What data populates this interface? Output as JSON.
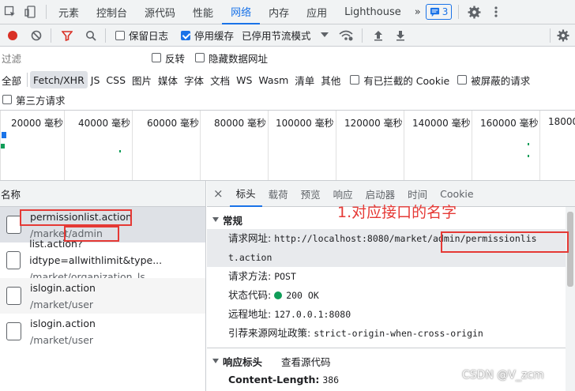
{
  "topbar": {
    "tabs": [
      "元素",
      "控制台",
      "源代码",
      "性能",
      "网络",
      "内存",
      "应用",
      "Lighthouse"
    ],
    "active_tab": "网络",
    "more": "»",
    "issues_count": "3"
  },
  "toolbar": {
    "preserve_log": "保留日志",
    "disable_cache": "停用缓存",
    "throttle": "已停用节流模式"
  },
  "filter": {
    "placeholder": "过滤",
    "invert": "反转",
    "hide_data_urls": "隐藏数据网址"
  },
  "types": {
    "items": [
      "全部",
      "Fetch/XHR",
      "JS",
      "CSS",
      "图片",
      "媒体",
      "字体",
      "文档",
      "WS",
      "Wasm",
      "清单",
      "其他"
    ],
    "active": "Fetch/XHR",
    "blocked_cookies": "有已拦截的 Cookie",
    "blocked_requests": "被屏蔽的请求",
    "third_party": "第三方请求"
  },
  "timeline": {
    "ticks": [
      "20000 毫秒",
      "40000 毫秒",
      "60000 毫秒",
      "80000 毫秒",
      "100000 毫秒",
      "120000 毫秒",
      "140000 毫秒",
      "160000 毫秒",
      "18000"
    ]
  },
  "requests": {
    "header": "名称",
    "items": [
      {
        "name": "permissionlist.action",
        "path": "/market/admin"
      },
      {
        "name": "list.action?idtype=allwithlimit&type...",
        "path": "/market/organization_ls"
      },
      {
        "name": "islogin.action",
        "path": "/market/user"
      },
      {
        "name": "islogin.action",
        "path": "/market/user"
      }
    ]
  },
  "detail": {
    "close": "×",
    "tabs": [
      "标头",
      "载荷",
      "预览",
      "响应",
      "启动器",
      "时间",
      "Cookie"
    ],
    "active_tab": "标头",
    "general_title": "常规",
    "url_label": "请求网址:",
    "url_line1": "http://localhost:8080/market/admin/permissionlis",
    "url_line2": "t.action",
    "method_label": "请求方法:",
    "method": "POST",
    "status_label": "状态代码:",
    "status": "200 OK",
    "remote_label": "远程地址:",
    "remote": "127.0.0.1:8080",
    "referrer_label": "引荐来源网址政策:",
    "referrer": "strict-origin-when-cross-origin",
    "response_headers_title": "响应标头",
    "view_source": "查看源代码",
    "content_length_label": "Content-Length:",
    "content_length": "386"
  },
  "annotation": "1.对应接口的名字",
  "watermark": "CSDN @V_zcm"
}
